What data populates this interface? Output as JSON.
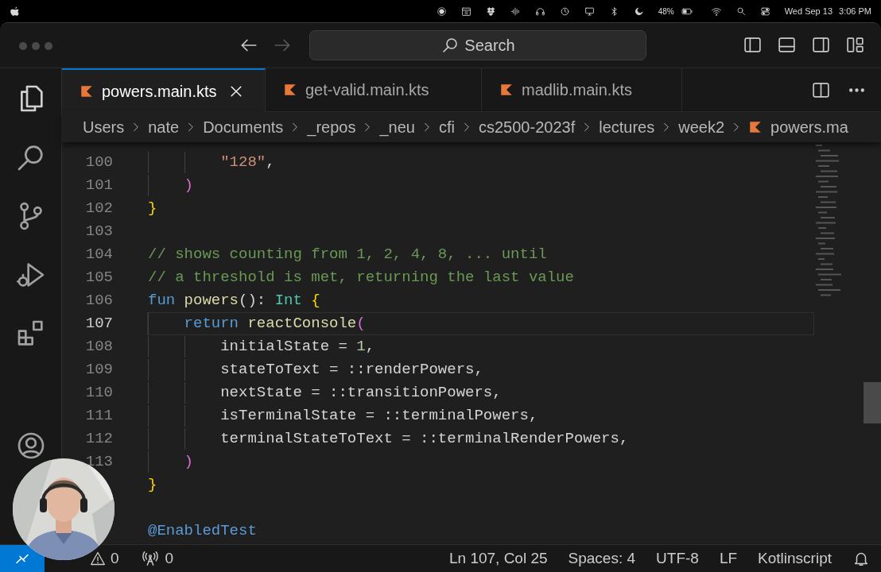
{
  "menu_bar": {
    "battery": "48%",
    "date": "Wed Sep 13",
    "time": "3:06 PM"
  },
  "title_bar": {
    "search_label": "Search"
  },
  "tabs": [
    {
      "label": "powers.main.kts",
      "selected": true
    },
    {
      "label": "get-valid.main.kts",
      "selected": false
    },
    {
      "label": "madlib.main.kts",
      "selected": false
    }
  ],
  "breadcrumb": [
    "Users",
    "nate",
    "Documents",
    "_repos",
    "_neu",
    "cfi",
    "cs2500-2023f",
    "lectures",
    "week2",
    "powers.ma"
  ],
  "editor": {
    "lines": [
      {
        "number": "100",
        "current": false,
        "tokens": [
          {
            "text": "        \"128\"",
            "kind": "string"
          },
          {
            "text": ",",
            "kind": "plain"
          }
        ]
      },
      {
        "number": "101",
        "current": false,
        "tokens": [
          {
            "text": "    )",
            "kind": "paren"
          }
        ]
      },
      {
        "number": "102",
        "current": false,
        "tokens": [
          {
            "text": "}",
            "kind": "brace"
          }
        ]
      },
      {
        "number": "103",
        "current": false
      },
      {
        "number": "104",
        "current": false,
        "tokens": [
          {
            "text": "// shows counting from 1, 2, 4, 8, ... until",
            "kind": "comment"
          }
        ]
      },
      {
        "number": "105",
        "current": false,
        "tokens": [
          {
            "text": "// a threshold is met, returning the last value",
            "kind": "comment"
          }
        ]
      },
      {
        "number": "106",
        "current": false,
        "tokens": [
          {
            "text": "fun ",
            "kind": "keyword"
          },
          {
            "text": "powers",
            "kind": "function"
          },
          {
            "text": "(): ",
            "kind": "plain"
          },
          {
            "text": "Int ",
            "kind": "type"
          },
          {
            "text": "{",
            "kind": "brace"
          }
        ]
      },
      {
        "number": "107",
        "current": true,
        "tokens": [
          {
            "text": "    return ",
            "kind": "keyword"
          },
          {
            "text": "reactConsole",
            "kind": "function"
          },
          {
            "text": "(",
            "kind": "paren"
          }
        ]
      },
      {
        "number": "108",
        "current": false,
        "tokens": [
          {
            "text": "        initialState = ",
            "kind": "plain"
          },
          {
            "text": "1",
            "kind": "number"
          },
          {
            "text": ",",
            "kind": "plain"
          }
        ]
      },
      {
        "number": "109",
        "current": false,
        "tokens": [
          {
            "text": "        stateToText = ::renderPowers,",
            "kind": "plain"
          }
        ]
      },
      {
        "number": "110",
        "current": false,
        "tokens": [
          {
            "text": "        nextState = ::transitionPowers,",
            "kind": "plain"
          }
        ]
      },
      {
        "number": "111",
        "current": false,
        "tokens": [
          {
            "text": "        isTerminalState = ::terminalPowers,",
            "kind": "plain"
          }
        ]
      },
      {
        "number": "112",
        "current": false,
        "tokens": [
          {
            "text": "        terminalStateToText = ::terminalRenderPowers,",
            "kind": "plain"
          }
        ]
      },
      {
        "number": "113",
        "current": false,
        "tokens": [
          {
            "text": "    )",
            "kind": "paren"
          }
        ]
      },
      {
        "current": false,
        "tokens": [
          {
            "text": "}",
            "kind": "brace"
          }
        ]
      },
      {
        "current": false
      },
      {
        "current": false,
        "tokens": [
          {
            "text": "@EnabledTest",
            "kind": "annotation"
          }
        ]
      }
    ]
  },
  "status_bar": {
    "warnings": "0",
    "ports": "0",
    "position": "Ln 107, Col 25",
    "indentation": "Spaces: 4",
    "encoding": "UTF-8",
    "eol": "LF",
    "language": "Kotlinscript"
  }
}
